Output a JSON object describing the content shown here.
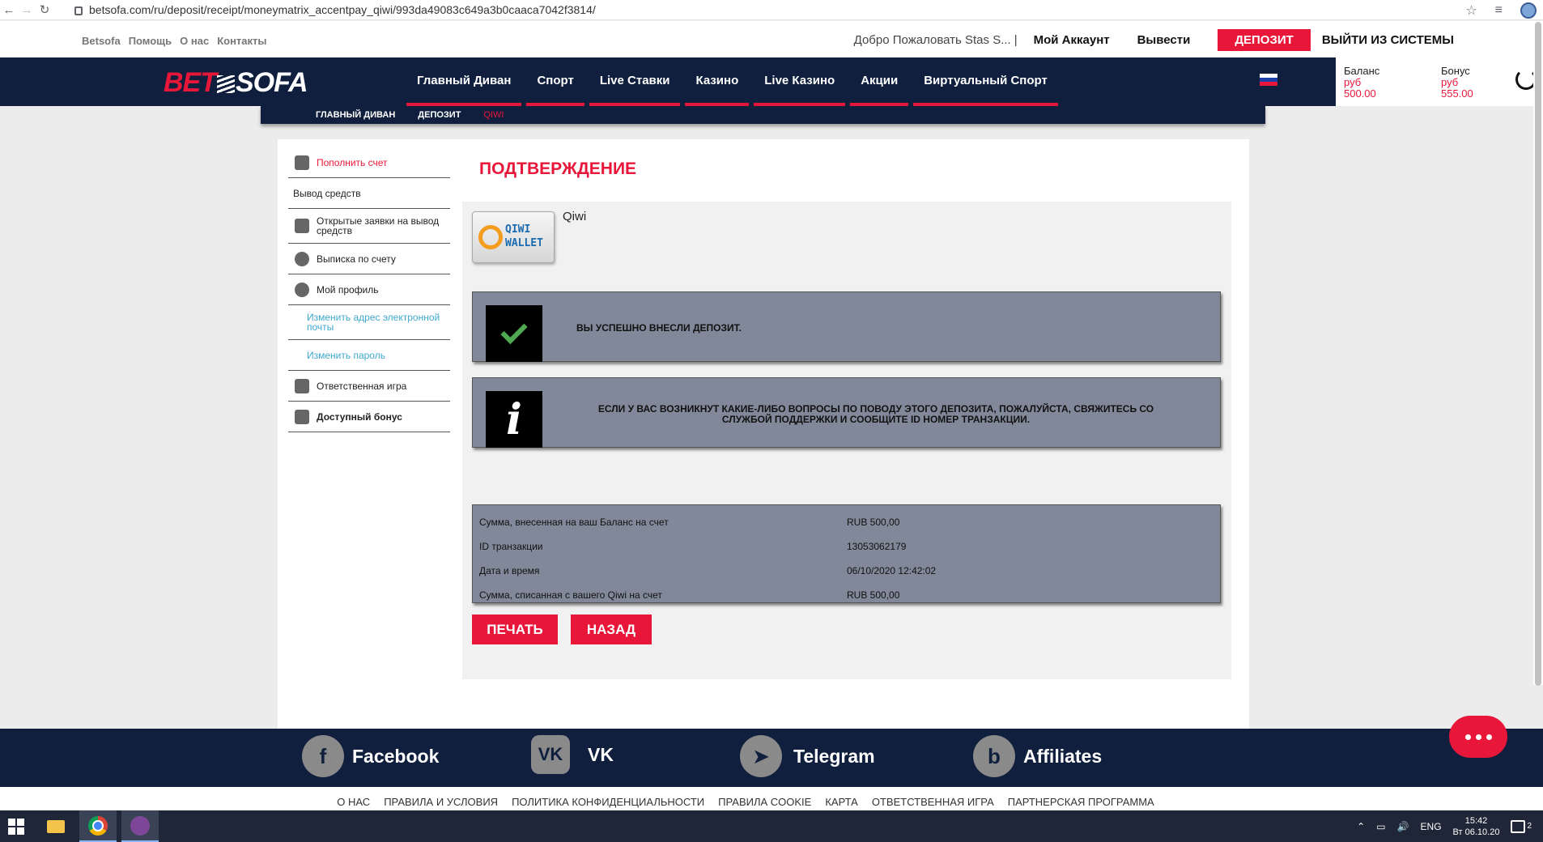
{
  "browser": {
    "url": "betsofa.com/ru/deposit/receipt/moneymatrix_accentpay_qiwi/993da49083c649a3b0caaca7042f3814/",
    "back_label": "←",
    "forward_label": "→",
    "reload_label": "↻",
    "star_label": "☆",
    "menu_label": "≡"
  },
  "utilbar": {
    "links": [
      "Betsofa",
      "Помощь",
      "О нас",
      "Контакты"
    ],
    "welcome": "Добро Пожаловать Stas S...",
    "welcome_sep": "|",
    "account": "Мой Аккаунт",
    "withdraw": "Вывести",
    "deposit": "ДЕПОЗИТ",
    "logout": "ВЫЙТИ ИЗ СИСТЕМЫ"
  },
  "logo": {
    "bet": "BET",
    "sofa": "SOFA"
  },
  "nav": {
    "items": [
      "Главный Диван",
      "Спорт",
      "Live Ставки",
      "Казино",
      "Live Казино",
      "Акции",
      "Виртуальный Спорт"
    ],
    "flag_colors": [
      "#ffffff",
      "#1c3fa8",
      "#e8173a"
    ]
  },
  "balance": {
    "balance_label": "Баланс",
    "balance_currency": "руб",
    "balance_value": "500.00",
    "bonus_label": "Бонус",
    "bonus_currency": "руб",
    "bonus_value": "555.00"
  },
  "breadcrumb": [
    "ГЛАВНЫЙ ДИВАН",
    "ДЕПОЗИТ",
    "QIWI"
  ],
  "sidemenu": [
    {
      "label": "Пополнить счет",
      "icon": "deposit-icon"
    },
    {
      "label": "Вывод средств",
      "icon": ""
    },
    {
      "label": "Открытые заявки на вывод средств",
      "icon": "pending-withdrawals-icon"
    },
    {
      "label": "Выписка по счету",
      "icon": "clock-icon"
    },
    {
      "label": "Мой профиль",
      "icon": "user-icon"
    },
    {
      "label": "Изменить адрес электронной почты",
      "icon": ""
    },
    {
      "label": "Изменить пароль",
      "icon": ""
    },
    {
      "label": "Ответственная игра",
      "icon": "scales-icon"
    },
    {
      "label": "Доступный бонус",
      "icon": "gift-icon"
    }
  ],
  "main": {
    "title": "ПОДТВЕРЖДЕНИЕ",
    "method": "Qiwi",
    "qiwi_logo": {
      "line1": "QIWI",
      "line2": "WALLET"
    },
    "success_msg": "ВЫ УСПЕШНО ВНЕСЛИ ДЕПОЗИТ.",
    "info_msg": "ЕСЛИ У ВАС ВОЗНИКНУТ КАКИЕ-ЛИБО ВОПРОСЫ ПО ПОВОДУ ЭТОГО ДЕПОЗИТА, ПОЖАЛУЙСТА, СВЯЖИТЕСЬ СО СЛУЖБОЙ ПОДДЕРЖКИ И СООБЩИТЕ ID НОМЕР ТРАНЗАКЦИИ.",
    "info_glyph": "i",
    "details": [
      {
        "key": "Сумма, внесенная на ваш Баланс на счет",
        "value": "RUB 500,00"
      },
      {
        "key": "ID транзакции",
        "value": "13053062179"
      },
      {
        "key": "Дата и время",
        "value": "06/10/2020 12:42:02"
      },
      {
        "key": "Сумма, списанная с вашего Qiwi на счет",
        "value": "RUB 500,00"
      }
    ],
    "print_label": "ПЕЧАТЬ",
    "back_label": "НАЗАД"
  },
  "social": [
    {
      "name": "Facebook",
      "glyph": "f"
    },
    {
      "name": "VK",
      "glyph": "VK"
    },
    {
      "name": "Telegram",
      "glyph": "➤"
    },
    {
      "name": "Affiliates",
      "glyph": "b"
    }
  ],
  "footer_links": [
    "О НАС",
    "ПРАВИЛА И УСЛОВИЯ",
    "ПОЛИТИКА КОНФИДЕНЦИАЛЬНОСТИ",
    "ПРАВИЛА COOKIE",
    "КАРТА",
    "ОТВЕТСТВЕННАЯ ИГРА",
    "ПАРТНЕРСКАЯ ПРОГРАММА"
  ],
  "taskbar": {
    "lang": "ENG",
    "time": "15:42",
    "date": "Вт 06.10.20",
    "notifications": "2",
    "tray_up": "⌃",
    "network": "▭",
    "volume": "🔊"
  },
  "colors": {
    "accent": "#e8173a",
    "navy": "#0f1f3d",
    "panel_gray": "#808899",
    "link_blue": "#41a8cf"
  }
}
